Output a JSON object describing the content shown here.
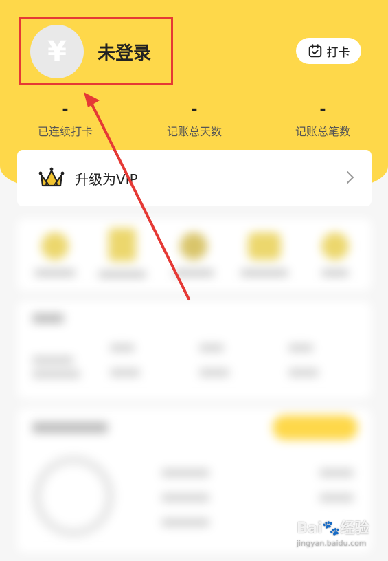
{
  "profile": {
    "avatar_symbol": "¥",
    "username": "未登录"
  },
  "checkin": {
    "label": "打卡",
    "icon": "calendar-check-icon"
  },
  "stats": [
    {
      "value": "-",
      "label": "已连续打卡"
    },
    {
      "value": "-",
      "label": "记账总天数"
    },
    {
      "value": "-",
      "label": "记账总笔数"
    }
  ],
  "vip": {
    "label": "升级为VIP",
    "icon": "crown-icon"
  },
  "colors": {
    "header": "#fed84a",
    "accent_red": "#e53935",
    "crown": "#f2c430"
  },
  "watermark": {
    "logo_left": "Bai",
    "logo_paw": "🐾",
    "logo_right": "经验",
    "url": "jingyan.baidu.com"
  }
}
